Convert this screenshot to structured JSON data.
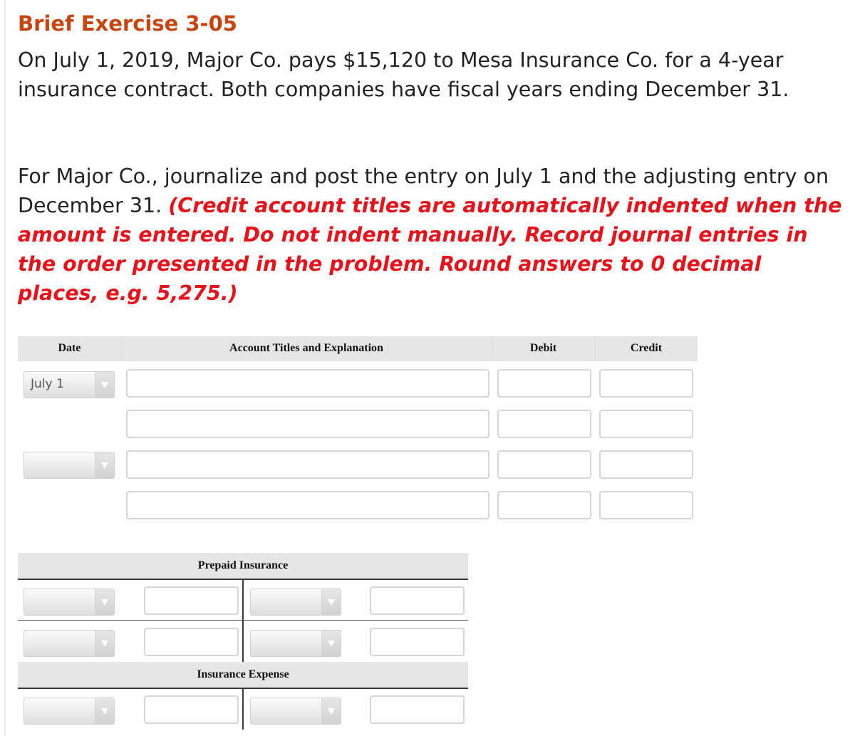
{
  "title": "Brief Exercise 3-05",
  "problem_text": "On July 1, 2019, Major Co. pays $15,120 to Mesa Insurance Co. for a 4-year insurance contract. Both companies have fiscal years ending December 31.",
  "instruction_text": "For Major Co., journalize and post the entry on July 1 and the adjusting entry on December 31.",
  "instruction_note": "(Credit account titles are automatically indented when the amount is entered. Do not indent manually. Record journal entries in the order presented in the problem. Round answers to 0 decimal places, e.g. 5,275.)",
  "colors": {
    "title": "#c8440f",
    "note": "#e8121b"
  },
  "journal": {
    "headers": {
      "date": "Date",
      "account": "Account Titles and Explanation",
      "debit": "Debit",
      "credit": "Credit"
    },
    "entries": [
      {
        "date": "July 1",
        "rows": [
          {
            "account": "",
            "debit": "",
            "credit": ""
          },
          {
            "account": "",
            "debit": "",
            "credit": ""
          }
        ]
      },
      {
        "date": "",
        "rows": [
          {
            "account": "",
            "debit": "",
            "credit": ""
          },
          {
            "account": "",
            "debit": "",
            "credit": ""
          }
        ]
      }
    ]
  },
  "t_accounts": [
    {
      "name": "Prepaid Insurance",
      "rows": [
        {
          "left_date": "",
          "left_amount": "",
          "right_date": "",
          "right_amount": ""
        },
        {
          "left_date": "",
          "left_amount": "",
          "right_date": "",
          "right_amount": ""
        }
      ]
    },
    {
      "name": "Insurance Expense",
      "rows": [
        {
          "left_date": "",
          "left_amount": "",
          "right_date": "",
          "right_amount": ""
        }
      ]
    }
  ],
  "icons": {
    "dropdown": "chevron-down-icon"
  }
}
